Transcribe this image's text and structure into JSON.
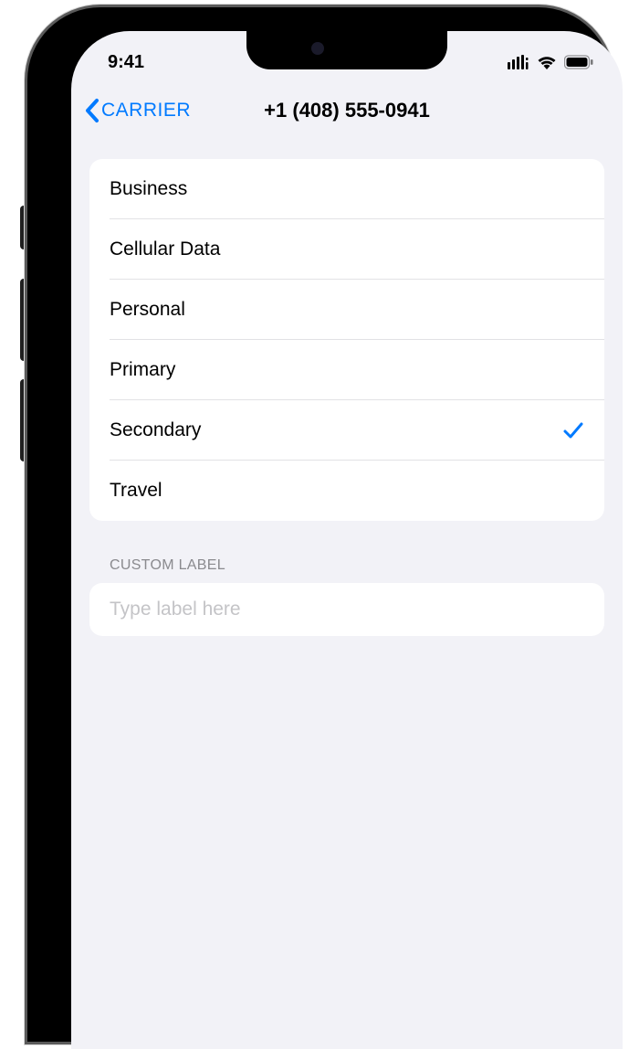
{
  "status_bar": {
    "time": "9:41"
  },
  "nav": {
    "back_label": "CARRIER",
    "title": "+1 (408) 555-0941"
  },
  "labels": {
    "items": [
      {
        "label": "Business",
        "selected": false
      },
      {
        "label": "Cellular Data",
        "selected": false
      },
      {
        "label": "Personal",
        "selected": false
      },
      {
        "label": "Primary",
        "selected": false
      },
      {
        "label": "Secondary",
        "selected": true
      },
      {
        "label": "Travel",
        "selected": false
      }
    ]
  },
  "custom_label": {
    "header": "CUSTOM LABEL",
    "placeholder": "Type label here",
    "value": ""
  },
  "colors": {
    "accent": "#007aff",
    "background": "#f2f2f7",
    "text_secondary": "#8a8a8e"
  }
}
